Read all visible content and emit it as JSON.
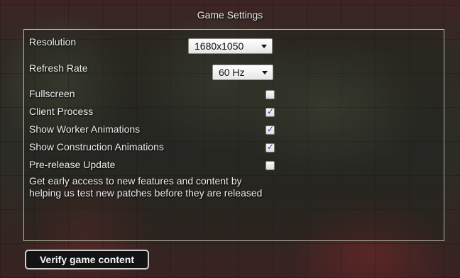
{
  "window": {
    "title": "Game Settings"
  },
  "settings": {
    "resolution": {
      "label": "Resolution",
      "value": "1680x1050"
    },
    "refresh_rate": {
      "label": "Refresh Rate",
      "value": "60 Hz"
    },
    "options": [
      {
        "label": "Fullscreen",
        "checked": false
      },
      {
        "label": "Client Process",
        "checked": true
      },
      {
        "label": "Show Worker Animations",
        "checked": true
      },
      {
        "label": "Show Construction Animations",
        "checked": true
      },
      {
        "label": "Pre-release Update",
        "checked": false
      }
    ],
    "prerelease_description": "Get early access to new features and content by helping us test new patches before they are released"
  },
  "footer": {
    "verify_label": "Verify game content"
  },
  "icons": {
    "checkmark": "checkmark-icon",
    "dropdown": "chevron-down-icon"
  },
  "colors": {
    "panel_border": "#b9b9a9",
    "text": "#ececec",
    "button_bg": "#131313",
    "check_mark": "#1f3f9a"
  }
}
